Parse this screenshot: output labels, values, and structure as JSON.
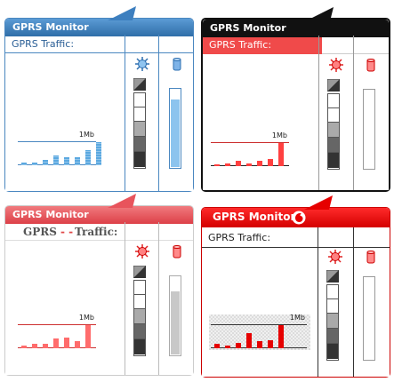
{
  "widgets": [
    {
      "id": "blue",
      "title": "GPRS Monitor",
      "traffic_label": "GPRS Traffic:",
      "threshold_label": "1Mb",
      "colors": {
        "title_bg": "#3d7fbf",
        "accent": "#5aa8e0",
        "border": "#4a87c0",
        "rule": "#4a87c0",
        "text": "#2b5f96"
      },
      "gauge_level": 0.85,
      "bars": [
        0.1,
        0.1,
        0.2,
        0.35,
        0.3,
        0.3,
        0.55,
        0.85
      ]
    },
    {
      "id": "black",
      "title": "GPRS Monitor",
      "traffic_label": "GPRS Traffic:",
      "threshold_label": "1Mb",
      "colors": {
        "title_bg": "#111111",
        "accent": "#ff4040",
        "border": "#111111",
        "rule": "#ff4040",
        "text": "#ffffff"
      },
      "gauge_level": 0.0,
      "bars": [
        0.05,
        0.1,
        0.2,
        0.1,
        0.2,
        0.25,
        0.85
      ]
    },
    {
      "id": "pink",
      "title": "GPRS Monitor",
      "traffic_label_left": "GPRS",
      "traffic_label_right": "Traffic:",
      "threshold_label": "1Mb",
      "colors": {
        "title_bg": "#e8545c",
        "accent": "#ff6c6c",
        "border": "#cccccc",
        "rule": "#cc2f2f",
        "text": "#555555"
      },
      "gauge_level": 0.8,
      "bars": [
        0.1,
        0.15,
        0.15,
        0.35,
        0.4,
        0.25,
        0.85
      ]
    },
    {
      "id": "red",
      "title": "GPRS Monitor",
      "traffic_label": "GPRS Traffic:",
      "threshold_label": "1Mb",
      "colors": {
        "title_bg": "#e60000",
        "accent": "#e60000",
        "border": "#cc0000",
        "rule": "#333333",
        "text": "#222222"
      },
      "gauge_level": 0.0,
      "bars": [
        0.15,
        0.1,
        0.2,
        0.55,
        0.25,
        0.3,
        0.85
      ]
    }
  ]
}
